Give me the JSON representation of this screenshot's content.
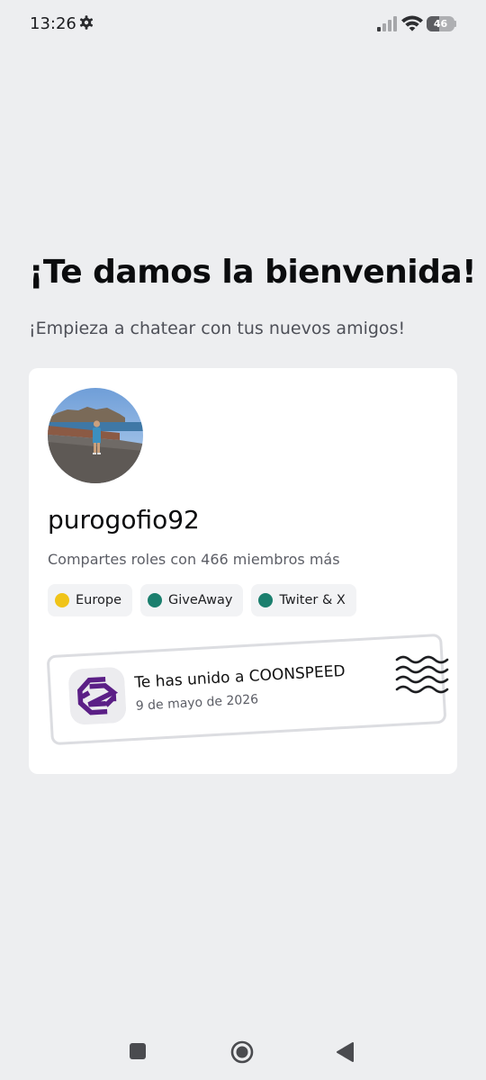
{
  "status_bar": {
    "time": "13:26",
    "battery_level": "46",
    "icons": [
      "gear-icon",
      "signal-icon",
      "wifi-icon",
      "battery-icon"
    ]
  },
  "welcome": {
    "title": "¡Te damos la bienvenida!",
    "subtitle": "¡Empieza a chatear con tus nuevos amigos!"
  },
  "profile": {
    "username": "purogofio92",
    "shared_roles_text": "Compartes roles con 466 miembros más",
    "roles": [
      {
        "name": "Europe",
        "color": "#f0c419"
      },
      {
        "name": "GiveAway",
        "color": "#1b7f6e"
      },
      {
        "name": "Twiter & X",
        "color": "#1b7f6e"
      }
    ]
  },
  "server_join": {
    "text": "Te has unido a COONSPEED",
    "date": "9 de mayo de 2026",
    "icon": "server-logo-icon"
  },
  "nav_bar": {
    "buttons": [
      "recent-apps-button",
      "home-button",
      "back-button"
    ]
  },
  "colors": {
    "background": "#edeef0",
    "card": "#ffffff",
    "server_logo": "#5b1f86"
  }
}
